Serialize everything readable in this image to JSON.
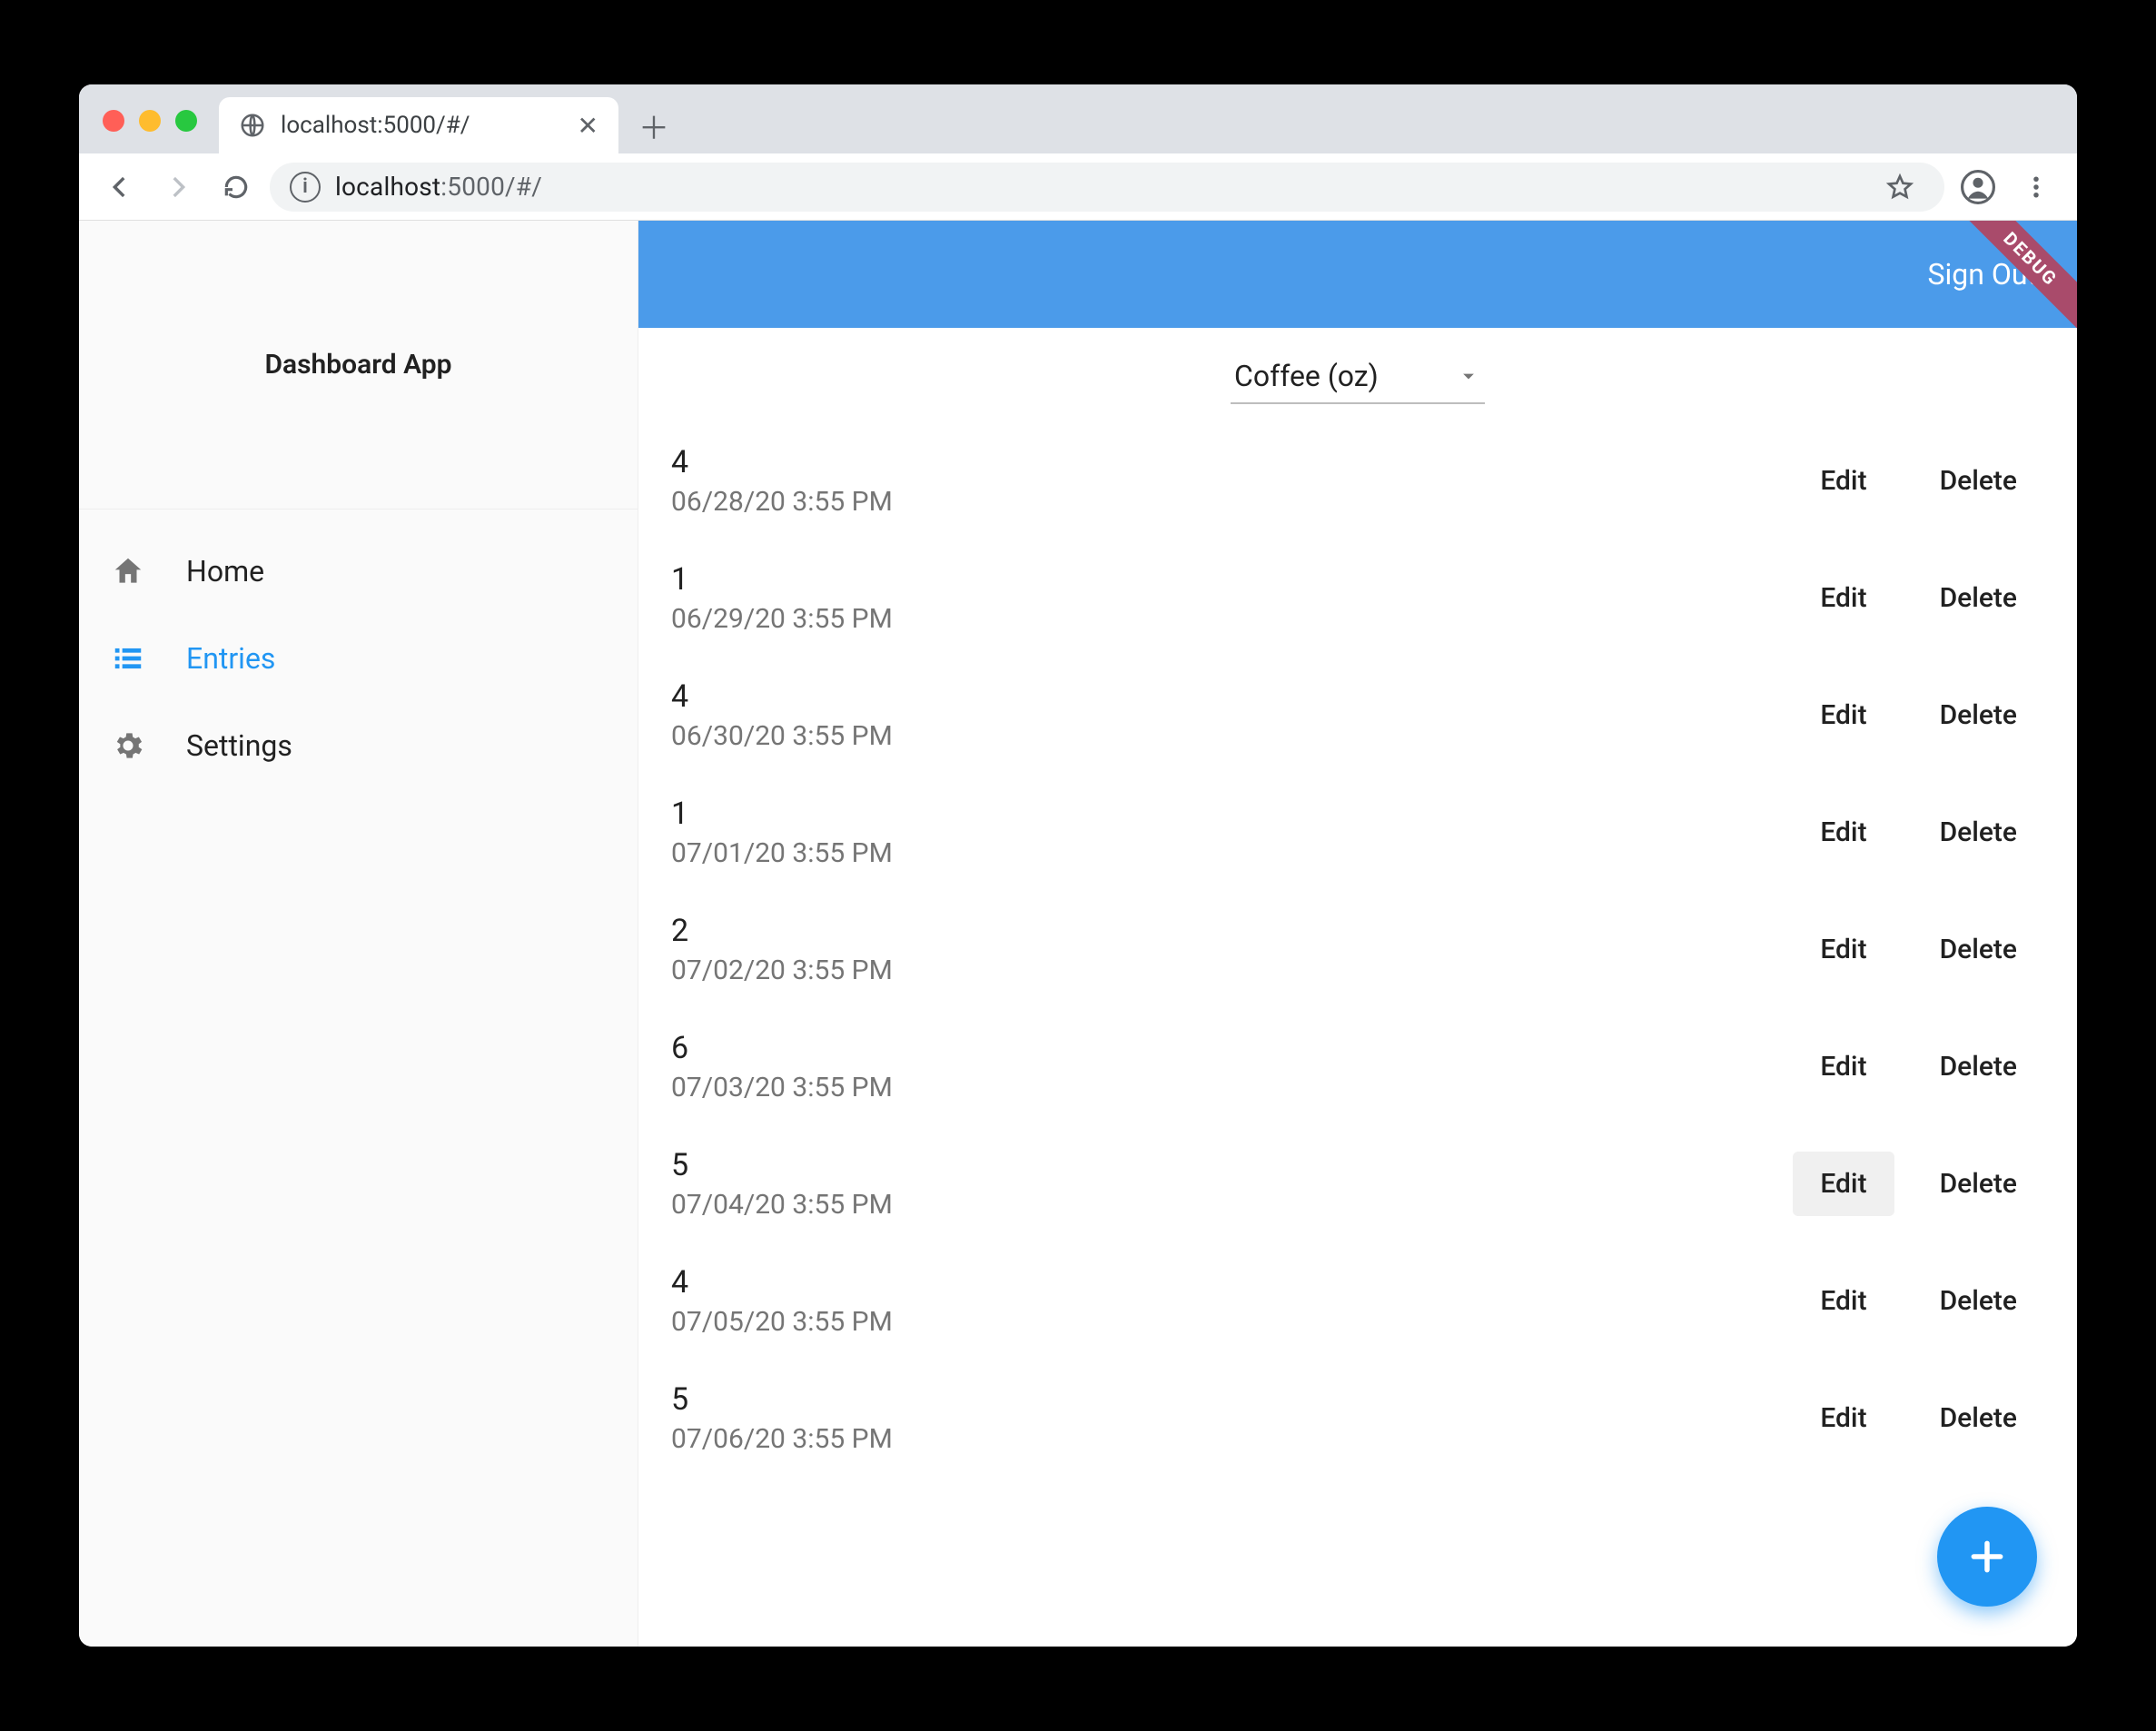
{
  "browser": {
    "tab_title": "localhost:5000/#/",
    "url_host": "localhost",
    "url_rest": ":5000/#/"
  },
  "sidebar": {
    "brand": "Dashboard App",
    "items": [
      {
        "icon": "home",
        "label": "Home",
        "active": false
      },
      {
        "icon": "list",
        "label": "Entries",
        "active": true
      },
      {
        "icon": "settings",
        "label": "Settings",
        "active": false
      }
    ]
  },
  "topbar": {
    "sign_out": "Sign Out",
    "debug_label": "DEBUG"
  },
  "dropdown": {
    "selected": "Coffee (oz)"
  },
  "actions": {
    "edit": "Edit",
    "delete": "Delete"
  },
  "entries": [
    {
      "value": "4",
      "timestamp": "06/28/20 3:55 PM",
      "edit_hover": false
    },
    {
      "value": "1",
      "timestamp": "06/29/20 3:55 PM",
      "edit_hover": false
    },
    {
      "value": "4",
      "timestamp": "06/30/20 3:55 PM",
      "edit_hover": false
    },
    {
      "value": "1",
      "timestamp": "07/01/20 3:55 PM",
      "edit_hover": false
    },
    {
      "value": "2",
      "timestamp": "07/02/20 3:55 PM",
      "edit_hover": false
    },
    {
      "value": "6",
      "timestamp": "07/03/20 3:55 PM",
      "edit_hover": false
    },
    {
      "value": "5",
      "timestamp": "07/04/20 3:55 PM",
      "edit_hover": true
    },
    {
      "value": "4",
      "timestamp": "07/05/20 3:55 PM",
      "edit_hover": false
    },
    {
      "value": "5",
      "timestamp": "07/06/20 3:55 PM",
      "edit_hover": false
    }
  ]
}
